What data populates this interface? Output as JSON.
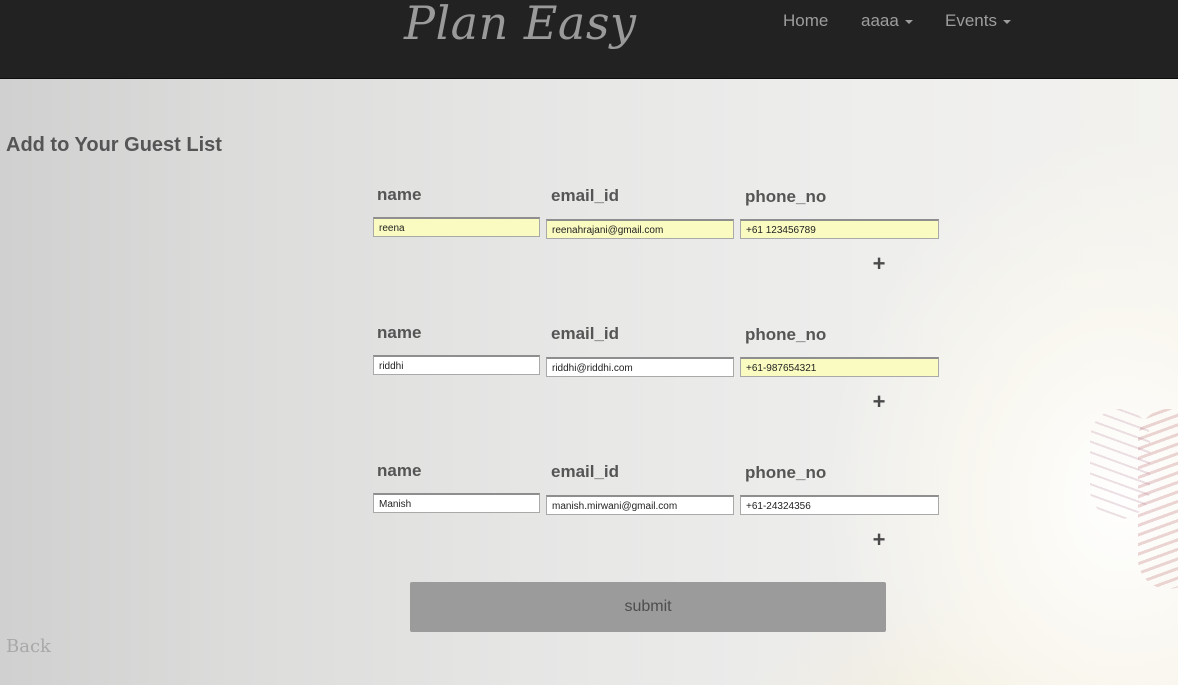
{
  "app": {
    "brand": "Plan Easy"
  },
  "nav": {
    "home": "Home",
    "user": "aaaa",
    "events": "Events"
  },
  "page": {
    "title": "Add to Your Guest List"
  },
  "form": {
    "columns": {
      "name": "name",
      "email": "email_id",
      "phone": "phone_no"
    },
    "guests": [
      {
        "name": "reena",
        "email": "reenahrajani@gmail.com",
        "phone": "+61 123456789",
        "add_label": "+"
      },
      {
        "name": "riddhi",
        "email": "riddhi@riddhi.com",
        "phone": "+61-987654321",
        "add_label": "+"
      },
      {
        "name": "Manish",
        "email": "manish.mirwani@gmail.com",
        "phone": "+61-24324356",
        "add_label": "+"
      }
    ],
    "submit_label": "submit"
  },
  "footer": {
    "back_label": "Back"
  },
  "colors": {
    "navbar": "#222222",
    "autofill": "#fafbc0",
    "submit": "#9b9b9b",
    "text": "#555555"
  }
}
